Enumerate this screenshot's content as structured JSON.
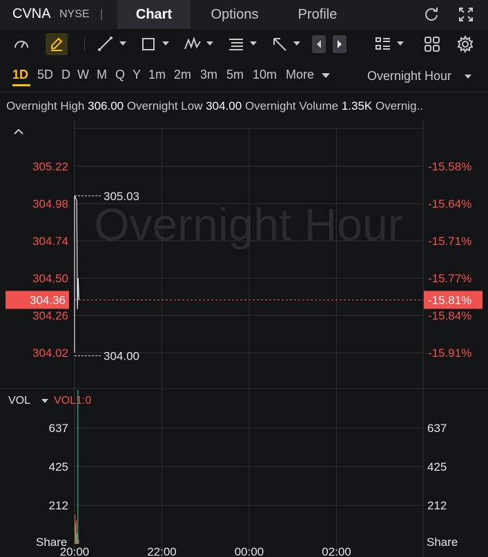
{
  "header": {
    "symbol": "CVNA",
    "exchange": "NYSE",
    "separator": "|",
    "tabs": [
      {
        "label": "Chart",
        "active": true
      },
      {
        "label": "Options",
        "active": false
      },
      {
        "label": "Profile",
        "active": false
      }
    ],
    "icons": [
      "refresh-icon",
      "fullscreen-icon"
    ]
  },
  "toolbar": {
    "icons": [
      "speedometer-icon",
      "pencil-icon",
      "line-tool-icon",
      "rectangle-tool-icon",
      "pattern-tool-icon",
      "text-tool-icon",
      "arrow-tool-icon",
      "prev-icon",
      "next-icon",
      "indicator-list-icon",
      "grid-layout-icon",
      "settings-icon"
    ]
  },
  "periods": {
    "items": [
      "1D",
      "5D",
      "D",
      "W",
      "M",
      "Q",
      "Y",
      "1m",
      "2m",
      "3m",
      "5m",
      "10m",
      "More"
    ],
    "active": "1D",
    "session": "Overnight Hour"
  },
  "stats": [
    {
      "label": "Overnight High",
      "value": "306.00"
    },
    {
      "label": "Overnight Low",
      "value": "304.00"
    },
    {
      "label": "Overnight Volume",
      "value": "1.35K"
    },
    {
      "label": "Overnig..",
      "value": ""
    }
  ],
  "colors": {
    "background": "#131416",
    "accent": "#ffc107",
    "down": "#f0524f",
    "up": "#2ebd85",
    "price_line": "#e6e6e6"
  },
  "chart_data": [
    {
      "type": "line",
      "watermark": "Overnight Hour",
      "y_left_ticks": [
        "305.22",
        "304.98",
        "304.74",
        "304.50",
        "304.26",
        "304.02"
      ],
      "y_right_ticks": [
        "-15.58%",
        "-15.64%",
        "-15.71%",
        "-15.77%",
        "-15.84%",
        "-15.91%"
      ],
      "x_ticks": [
        "20:00",
        "22:00",
        "00:00",
        "02:00"
      ],
      "ylim": [
        303.9,
        305.35
      ],
      "current_price": "304.36",
      "current_change": "-15.81%",
      "high_marker": "305.03",
      "low_marker": "304.00",
      "series": [
        {
          "x": [
            "20:00",
            "20:00",
            "20:03",
            "20:04",
            "20:05",
            "20:06"
          ],
          "values": [
            304.02,
            305.03,
            305.0,
            304.3,
            304.5,
            304.36
          ]
        }
      ]
    },
    {
      "type": "bar",
      "title": "VOL",
      "indicator": "VOL1:0",
      "y_ticks": [
        "637",
        "425",
        "212"
      ],
      "unit_label": "Share",
      "ylim": [
        0,
        850
      ],
      "bars": [
        {
          "x": "20:00",
          "value": 160,
          "direction": "down"
        },
        {
          "x": "20:01",
          "value": 110,
          "direction": "up"
        },
        {
          "x": "20:02",
          "value": 130,
          "direction": "down"
        },
        {
          "x": "20:03",
          "value": 60,
          "direction": "up"
        },
        {
          "x": "20:04",
          "value": 845,
          "direction": "up"
        },
        {
          "x": "20:05",
          "value": 25,
          "direction": "down"
        }
      ]
    }
  ]
}
